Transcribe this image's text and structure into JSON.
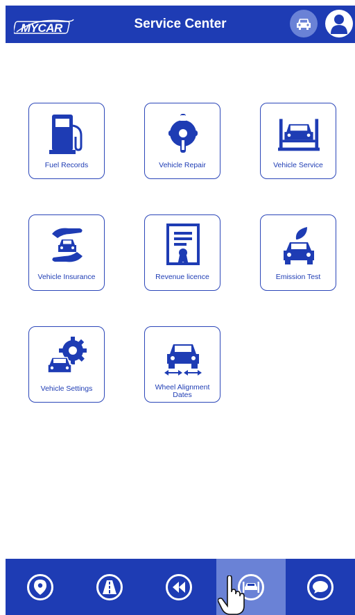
{
  "header": {
    "logo_text": "MYCAR",
    "title": "Service Center",
    "icons": [
      "car-icon",
      "user-icon"
    ]
  },
  "tiles": [
    {
      "label": "Fuel Records",
      "icon": "fuel-pump-icon"
    },
    {
      "label": "Vehicle Repair",
      "icon": "repair-tools-icon"
    },
    {
      "label": "Vehicle Service",
      "icon": "car-lift-icon"
    },
    {
      "label": "Vehicle Insurance",
      "icon": "insurance-hands-icon"
    },
    {
      "label": "Revenue licence",
      "icon": "certificate-icon"
    },
    {
      "label": "Emission Test",
      "icon": "eco-car-icon"
    },
    {
      "label": "Vehicle Settings",
      "icon": "car-gear-icon"
    },
    {
      "label": "Wheel Alignment Dates",
      "icon": "wheel-alignment-icon"
    }
  ],
  "bottom_nav": [
    {
      "icon": "location-pin-icon",
      "active": false
    },
    {
      "icon": "road-icon",
      "active": false
    },
    {
      "icon": "rewind-icon",
      "active": false
    },
    {
      "icon": "car-service-icon",
      "active": true
    },
    {
      "icon": "chat-bubble-icon",
      "active": false
    }
  ],
  "colors": {
    "primary": "#1e3cb4",
    "active_tab": "#6a82d6"
  }
}
